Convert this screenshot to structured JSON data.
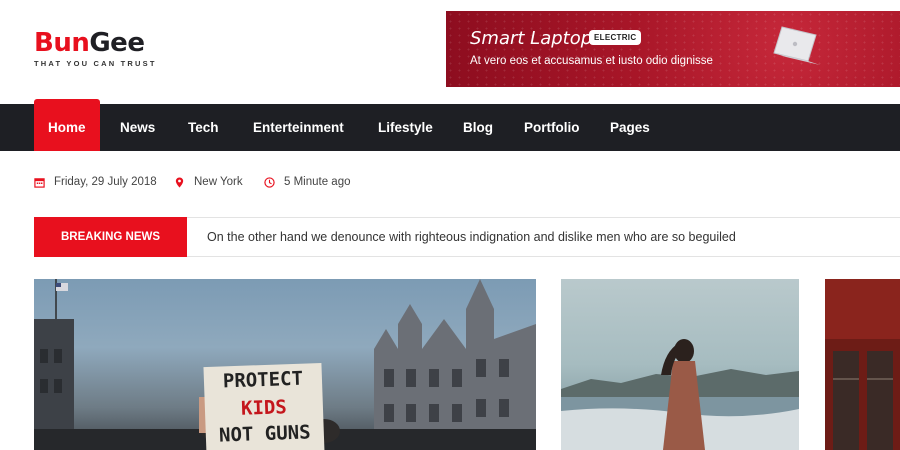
{
  "brand": {
    "name_part1": "Bun",
    "name_part2": "Gee",
    "tagline": "THAT YOU CAN TRUST",
    "accent_color": "#e8101e",
    "dark_color": "#1e1f24"
  },
  "ad": {
    "title": "Smart Laptop",
    "badge": "ELECTRIC",
    "subtitle": "At vero eos et accusamus et iusto odio dignisse"
  },
  "nav": {
    "items": [
      {
        "label": "Home",
        "active": true
      },
      {
        "label": "News"
      },
      {
        "label": "Tech"
      },
      {
        "label": "Enterteinment"
      },
      {
        "label": "Lifestyle"
      },
      {
        "label": "Blog"
      },
      {
        "label": "Portfolio"
      },
      {
        "label": "Pages"
      }
    ]
  },
  "meta": {
    "date": "Friday, 29 July 2018",
    "location": "New York",
    "time_ago": "5 Minute ago",
    "date_icon": "calendar-icon",
    "location_icon": "map-pin-icon",
    "time_icon": "clock-icon"
  },
  "breaking": {
    "label": "BREAKING NEWS",
    "text": "On the other hand we denounce with righteous indignation and dislike men who are so beguiled"
  },
  "cards": {
    "protest_sign": [
      "PROTECT",
      "KIDS",
      "NOT GUNS"
    ]
  }
}
